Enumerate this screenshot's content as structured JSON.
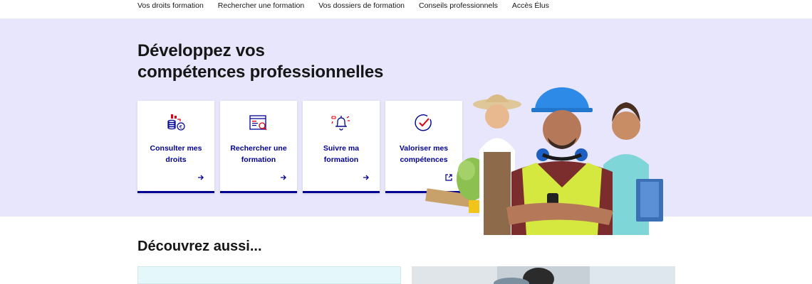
{
  "nav": {
    "items": [
      {
        "label": "Vos droits formation"
      },
      {
        "label": "Rechercher une formation"
      },
      {
        "label": "Vos dossiers de formation"
      },
      {
        "label": "Conseils professionnels"
      },
      {
        "label": "Accès Élus"
      }
    ]
  },
  "hero": {
    "title_line1": "Développez vos",
    "title_line2": "compétences professionnelles",
    "cards": [
      {
        "line1": "Consulter mes",
        "line2": "droits",
        "icon": "coins-euro-icon",
        "action": "arrow-right-icon"
      },
      {
        "line1": "Rechercher une",
        "line2": "formation",
        "icon": "search-document-icon",
        "action": "arrow-right-icon"
      },
      {
        "line1": "Suivre ma",
        "line2": "formation",
        "icon": "notification-bell-icon",
        "action": "arrow-right-icon"
      },
      {
        "line1": "Valoriser mes",
        "line2": "compétences",
        "icon": "check-circle-icon",
        "action": "external-link-icon"
      }
    ]
  },
  "discover": {
    "title": "Découvrez aussi..."
  },
  "colors": {
    "hero_bg": "#e8e6fc",
    "accent": "#000091",
    "icon_red": "#e1000f"
  }
}
